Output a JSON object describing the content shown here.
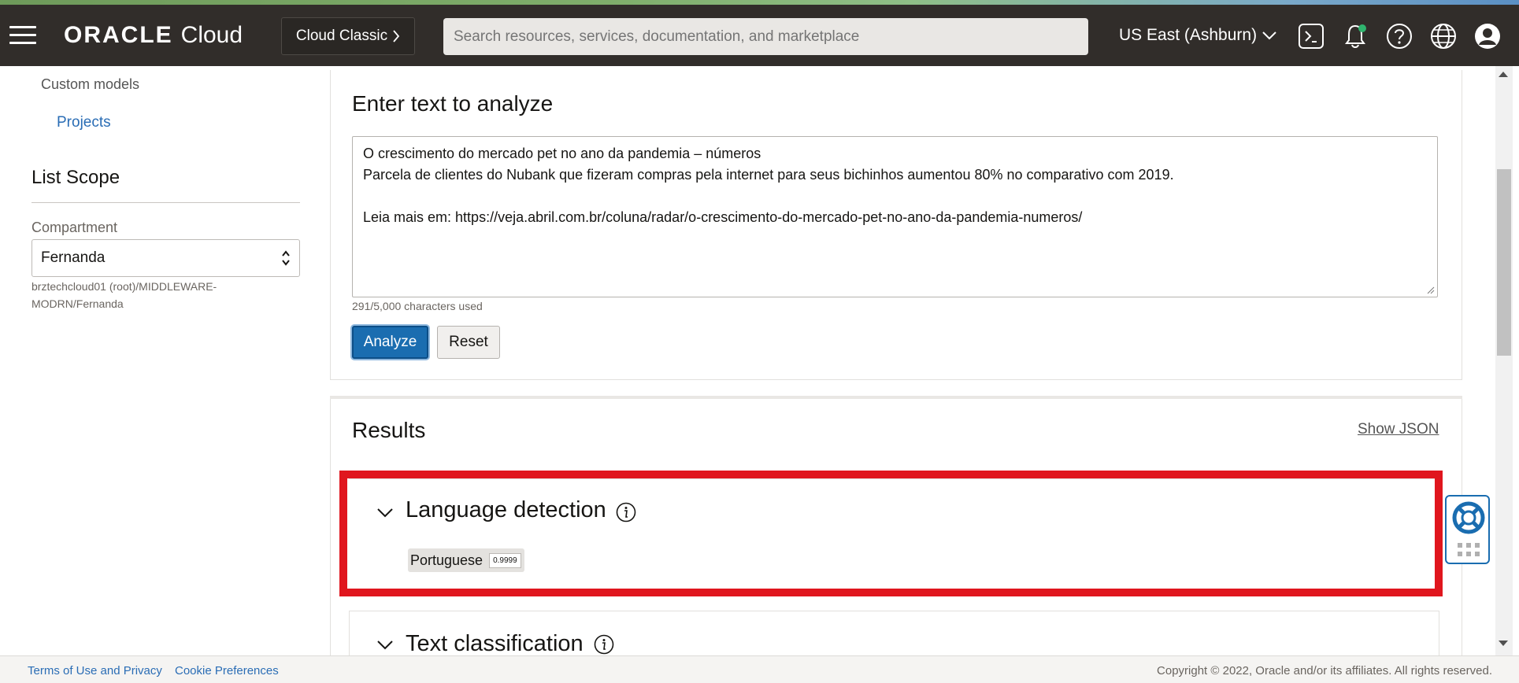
{
  "header": {
    "brand_oracle": "ORACLE",
    "brand_cloud": "Cloud",
    "classic_label": "Cloud Classic",
    "search_placeholder": "Search resources, services, documentation, and marketplace",
    "region_label": "US East (Ashburn)"
  },
  "sidebar": {
    "custom_models": "Custom models",
    "projects": "Projects",
    "list_scope": "List Scope",
    "compartment_label": "Compartment",
    "compartment_value": "Fernanda",
    "compartment_path": "brztechcloud01 (root)/MIDDLEWARE-MODRN/Fernanda"
  },
  "analyze_panel": {
    "title": "Enter text to analyze",
    "text_lines": [
      "O crescimento do mercado pet no ano da pandemia – números",
      "Parcela de clientes do Nubank que fizeram compras pela internet para seus bichinhos aumentou 80% no comparativo com 2019.",
      "",
      "Leia mais em: https://veja.abril.com.br/coluna/radar/o-crescimento-do-mercado-pet-no-ano-da-pandemia-numeros/"
    ],
    "chars_used": "291/5,000 characters used",
    "analyze_button": "Analyze",
    "reset_button": "Reset"
  },
  "results": {
    "title": "Results",
    "show_json": "Show JSON",
    "language_detection": {
      "title": "Language detection",
      "language": "Portuguese",
      "score": "0.9999"
    },
    "text_classification": {
      "title": "Text classification"
    }
  },
  "footer": {
    "terms": "Terms of Use and Privacy",
    "cookies": "Cookie Preferences",
    "copyright": "Copyright © 2022, Oracle and/or its affiliates. All rights reserved."
  },
  "colors": {
    "header_bg": "#312d2a",
    "link_blue": "#2a6db5",
    "primary_button": "#1a6db0",
    "highlight_red": "#e0161e"
  },
  "icons": [
    "hamburger-icon",
    "chevron-right-icon",
    "chevron-down-icon",
    "cloud-shell-icon",
    "bell-icon",
    "help-icon",
    "globe-icon",
    "user-icon",
    "info-icon",
    "lifebuoy-icon",
    "grid-icon",
    "select-caret-icon"
  ]
}
